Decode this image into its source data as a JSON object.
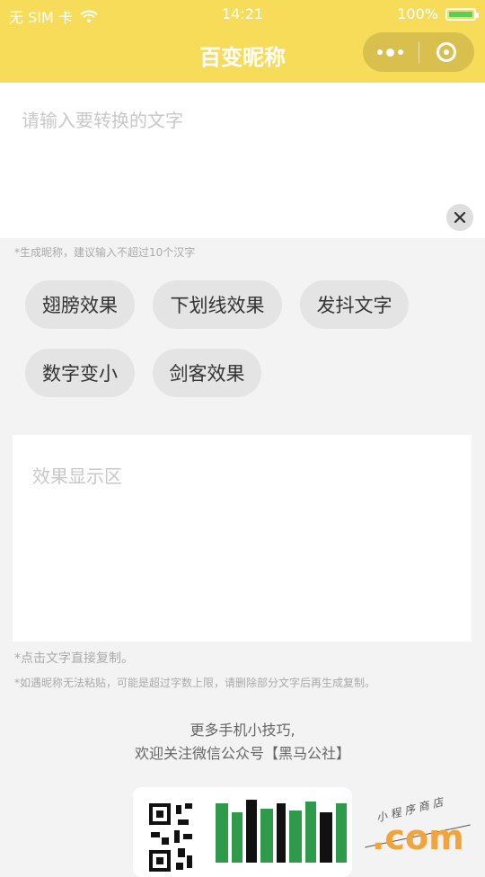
{
  "status_bar": {
    "carrier": "无 SIM 卡",
    "time": "14:21",
    "battery_percent": "100%",
    "wifi_icon": "wifi-icon"
  },
  "nav": {
    "title": "百变昵称",
    "menu_icon": "more-dots-icon",
    "close_icon": "target-circle-icon"
  },
  "input": {
    "placeholder": "请输入要转换的文字",
    "value": "",
    "clear_icon": "close-icon",
    "hint": "*生成昵称，建议输入不超过10个汉字"
  },
  "effects": [
    {
      "label": "翅膀效果"
    },
    {
      "label": "下划线效果"
    },
    {
      "label": "发抖文字"
    },
    {
      "label": "数字变小"
    },
    {
      "label": "剑客效果"
    }
  ],
  "result": {
    "placeholder": "效果显示区",
    "hint_copy": "*点击文字直接复制。",
    "hint_paste": "*如遇昵称无法粘贴，可能是超过字数上限，请删除部分文字后再生成复制。"
  },
  "promo": {
    "line1": "更多手机小技巧,",
    "line2": "欢迎关注微信公众号【黑马公社】"
  },
  "watermark": {
    "text_com": ".com",
    "text_sign": "小程序商店"
  },
  "colors": {
    "brand_yellow": "#f7dc5a",
    "chip_bg": "#e4e4e4",
    "battery_green": "#55d05b",
    "watermark_orange": "#f2a43c"
  }
}
